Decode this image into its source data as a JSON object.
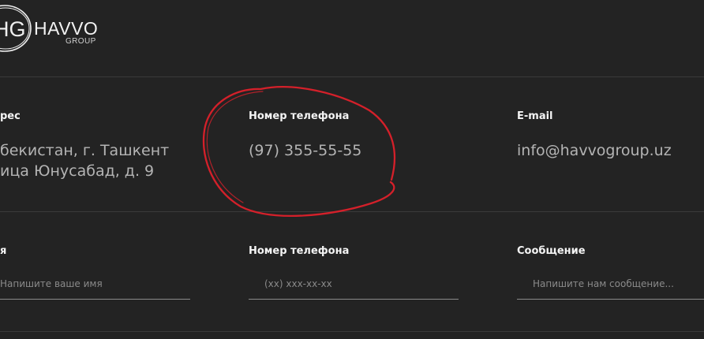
{
  "brand": {
    "mark_letters": "HG",
    "name": "HAVVO",
    "sub": "GROUP"
  },
  "info": {
    "address_label": "рес",
    "address_line1": "бекистан, г. Ташкент",
    "address_line2": "ица Юнусабад, д. 9",
    "phone_label": "Номер телефона",
    "phone_value": "(97) 355-55-55",
    "email_label": "E-mail",
    "email_value": "info@havvogroup.uz"
  },
  "form": {
    "name_label": "я",
    "name_placeholder": "Напишите ваше имя",
    "name_value": "",
    "phone_label": "Номер телефона",
    "phone_placeholder": "(xx) xxx-xx-xx",
    "phone_value": "",
    "message_label": "Сообщение",
    "message_placeholder": "Напишите нам сообщение...",
    "message_value": ""
  },
  "colors": {
    "background": "#232323",
    "annotation": "#d4202a"
  }
}
